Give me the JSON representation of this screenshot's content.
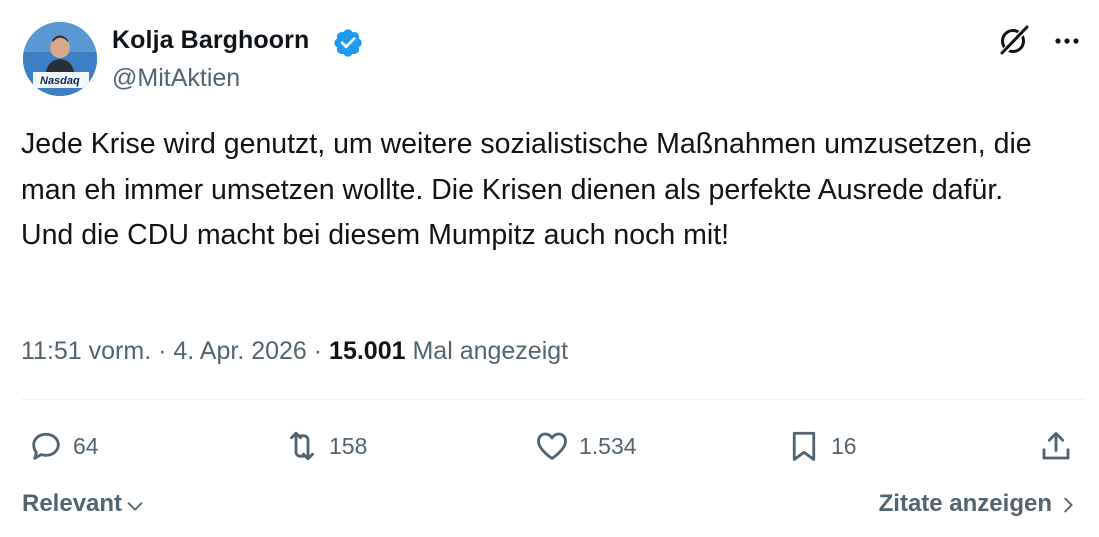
{
  "author": {
    "name": "Kolja Barghoorn",
    "handle": "@MitAktien",
    "avatar_badge_text": "Nasdaq",
    "verified": true
  },
  "tweet": {
    "text": "Jede Krise wird genutzt, um weitere sozialistische Maßnahmen umzusetzen, die man eh immer umsetzen wollte. Die Krisen dienen als perfekte Ausrede dafür. Und die CDU macht bei diesem Mumpitz auch noch mit!"
  },
  "meta": {
    "time": "11:51 vorm.",
    "separator": " · ",
    "date": "4. Apr. 2026",
    "views_count": "15.001",
    "views_label": " Mal angezeigt"
  },
  "actions": {
    "replies": "64",
    "reposts": "158",
    "likes": "1.534",
    "bookmarks": "16"
  },
  "footer": {
    "sort_label": "Relevant",
    "quotes_label": "Zitate anzeigen"
  },
  "colors": {
    "text": "#0f1419",
    "secondary": "#536471",
    "verified": "#1d9bf0",
    "divider": "#eff3f4"
  },
  "icons": [
    "grok-icon",
    "more-icon",
    "reply-icon",
    "repost-icon",
    "like-icon",
    "bookmark-icon",
    "share-icon",
    "chevron-down-icon",
    "chevron-right-icon",
    "verified-badge-icon"
  ]
}
